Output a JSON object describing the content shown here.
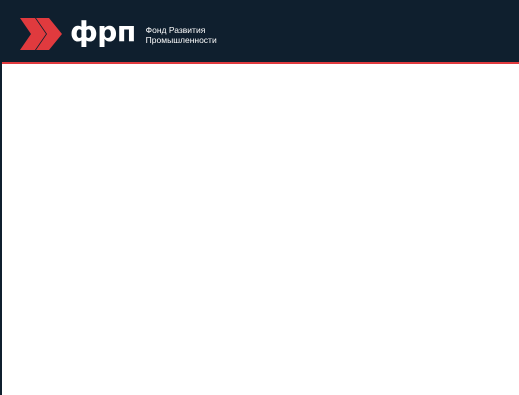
{
  "header": {
    "logo": {
      "icon": "double-chevron-right-icon",
      "wordmark": "фрп",
      "tagline_line1": "Фонд Развития",
      "tagline_line2": "Промышленности"
    },
    "colors": {
      "background": "#0f1f2e",
      "accent": "#e03a3e",
      "text": "#ffffff"
    }
  }
}
